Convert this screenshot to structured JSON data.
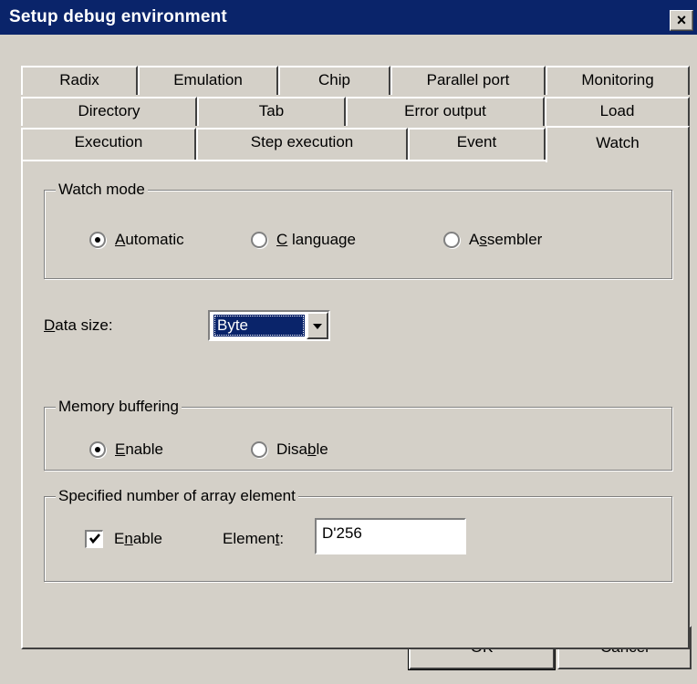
{
  "window": {
    "title": "Setup debug environment",
    "close_glyph": "×"
  },
  "tabs": {
    "row1": [
      "Radix",
      "Emulation",
      "Chip",
      "Parallel port",
      "Monitoring"
    ],
    "row2": [
      "Directory",
      "Tab",
      "Error output",
      "Load"
    ],
    "row3": [
      "Execution",
      "Step execution",
      "Event",
      "Watch"
    ],
    "active": "Watch"
  },
  "watch_mode": {
    "legend": "Watch mode",
    "options": [
      {
        "pre": "",
        "key": "A",
        "post": "utomatic",
        "selected": true
      },
      {
        "pre": "",
        "key": "C",
        "post": " language",
        "selected": false
      },
      {
        "pre": "A",
        "key": "s",
        "post": "sembler",
        "selected": false
      }
    ]
  },
  "data_size": {
    "pre": "",
    "key": "D",
    "post": "ata size:",
    "value": "Byte"
  },
  "memory_buffering": {
    "legend": "Memory buffering",
    "options": [
      {
        "pre": "",
        "key": "E",
        "post": "nable",
        "selected": true
      },
      {
        "pre": "Disa",
        "key": "b",
        "post": "le",
        "selected": false
      }
    ]
  },
  "array_element": {
    "legend": "Specified number of array element",
    "enable": {
      "pre": "E",
      "key": "n",
      "post": "able",
      "checked": true
    },
    "element_label": {
      "pre": "Elemen",
      "key": "t",
      "post": ":"
    },
    "element_value": "D'256"
  },
  "buttons": {
    "ok": "OK",
    "cancel": "Cancel"
  },
  "colors": {
    "titlebar": "#0a246a",
    "face": "#d4d0c8",
    "highlight": "#0a246a"
  }
}
